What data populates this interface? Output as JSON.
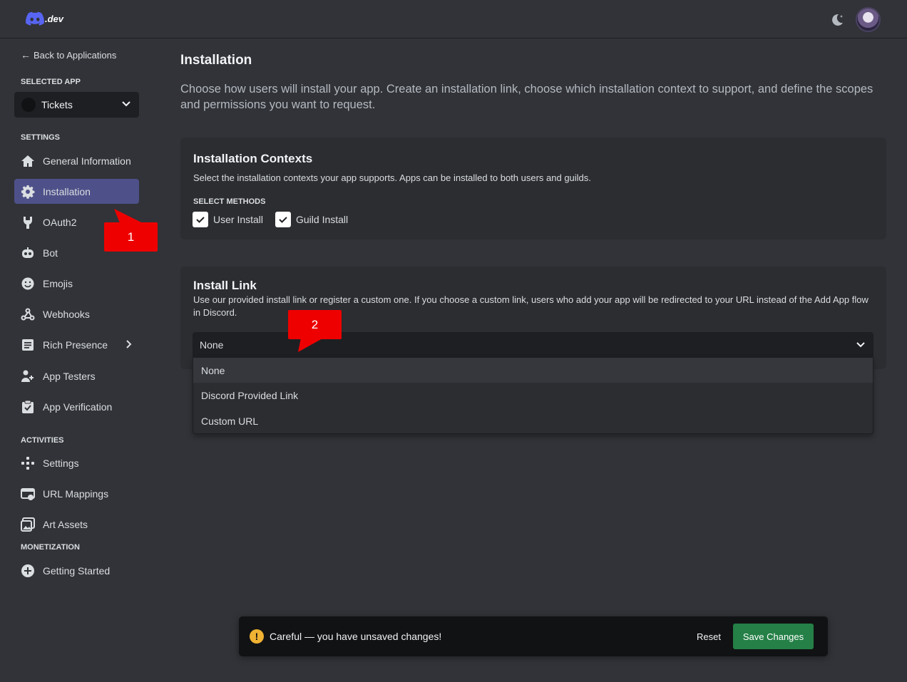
{
  "topbar": {
    "logo_text": ".dev",
    "theme_icon": "moon-icon",
    "avatar": "user-avatar"
  },
  "sidebar": {
    "back_label": "Back to Applications",
    "selected_app_heading": "SELECTED APP",
    "selected_app_name": "Tickets",
    "settings_heading": "SETTINGS",
    "settings_items": [
      {
        "label": "General Information",
        "icon": "home-icon"
      },
      {
        "label": "Installation",
        "icon": "gear-icon",
        "active": true
      },
      {
        "label": "OAuth2",
        "icon": "wrench-icon"
      },
      {
        "label": "Bot",
        "icon": "bot-icon"
      },
      {
        "label": "Emojis",
        "icon": "smile-icon"
      },
      {
        "label": "Webhooks",
        "icon": "webhook-icon"
      },
      {
        "label": "Rich Presence",
        "icon": "document-icon"
      },
      {
        "label": "App Testers",
        "icon": "user-plus-icon"
      },
      {
        "label": "App Verification",
        "icon": "clipboard-check-icon"
      }
    ],
    "activities_heading": "ACTIVITIES",
    "activities_items": [
      {
        "label": "Settings",
        "icon": "gamepad-icon"
      },
      {
        "label": "URL Mappings",
        "icon": "url-icon"
      },
      {
        "label": "Art Assets",
        "icon": "image-icon"
      }
    ],
    "monetization_heading": "MONETIZATION",
    "monetization_items": [
      {
        "label": "Getting Started",
        "icon": "plus-circle-icon"
      }
    ]
  },
  "main": {
    "title": "Installation",
    "description": "Choose how users will install your app. Create an installation link, choose which installation context to support, and define the scopes and permissions you want to request.",
    "contexts": {
      "title": "Installation Contexts",
      "description": "Select the installation contexts your app supports. Apps can be installed to both users and guilds.",
      "methods_label": "SELECT METHODS",
      "methods": [
        {
          "label": "User Install",
          "checked": true
        },
        {
          "label": "Guild Install",
          "checked": true
        }
      ]
    },
    "install_link": {
      "title": "Install Link",
      "description": "Use our provided install link or register a custom one. If you choose a custom link, users who add your app will be redirected to your URL instead of the Add App flow in Discord.",
      "selected": "None",
      "options": [
        "None",
        "Discord Provided Link",
        "Custom URL"
      ]
    }
  },
  "callouts": [
    "1",
    "2"
  ],
  "savebar": {
    "message": "Careful — you have unsaved changes!",
    "reset_label": "Reset",
    "save_label": "Save Changes"
  },
  "colors": {
    "background": "#313338",
    "card": "#2b2d31",
    "active_nav": "#4e5189",
    "save_green": "#248046",
    "callout_red": "#ee0000",
    "warning": "#f0b232"
  }
}
